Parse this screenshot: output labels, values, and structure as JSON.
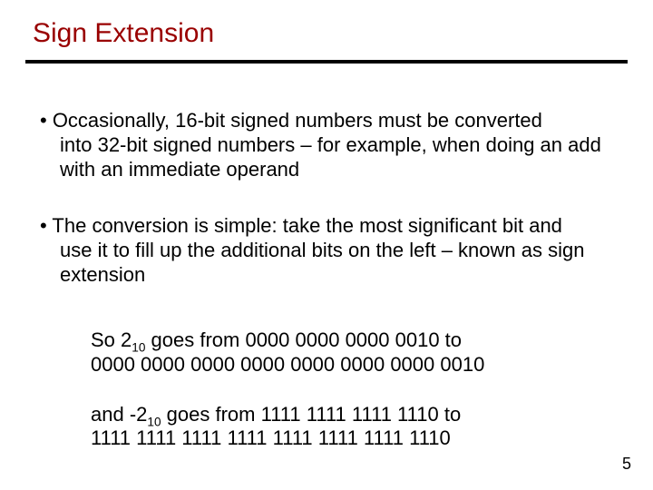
{
  "title": "Sign Extension",
  "bullets": [
    {
      "first_line": "• Occasionally, 16-bit signed numbers must be converted",
      "rest": "into 32-bit signed numbers – for example, when doing an add with an immediate operand"
    },
    {
      "first_line": "• The conversion is simple: take the most significant bit and",
      "rest": "use it to fill up the additional bits on the left – known as sign extension"
    }
  ],
  "examples": [
    {
      "prefix": "   So 2",
      "sub": "10",
      "mid": " goes from  0000 0000 0000 0010   to",
      "line2": "0000 0000 0000 0000 0000 0000 0000 0010"
    },
    {
      "prefix": "  and -2",
      "sub": "10",
      "mid": " goes from 1111 1111 1111 1110   to",
      "line2": "1111 1111 1111 1111 1111 1111 1111 1110"
    }
  ],
  "page_number": "5"
}
